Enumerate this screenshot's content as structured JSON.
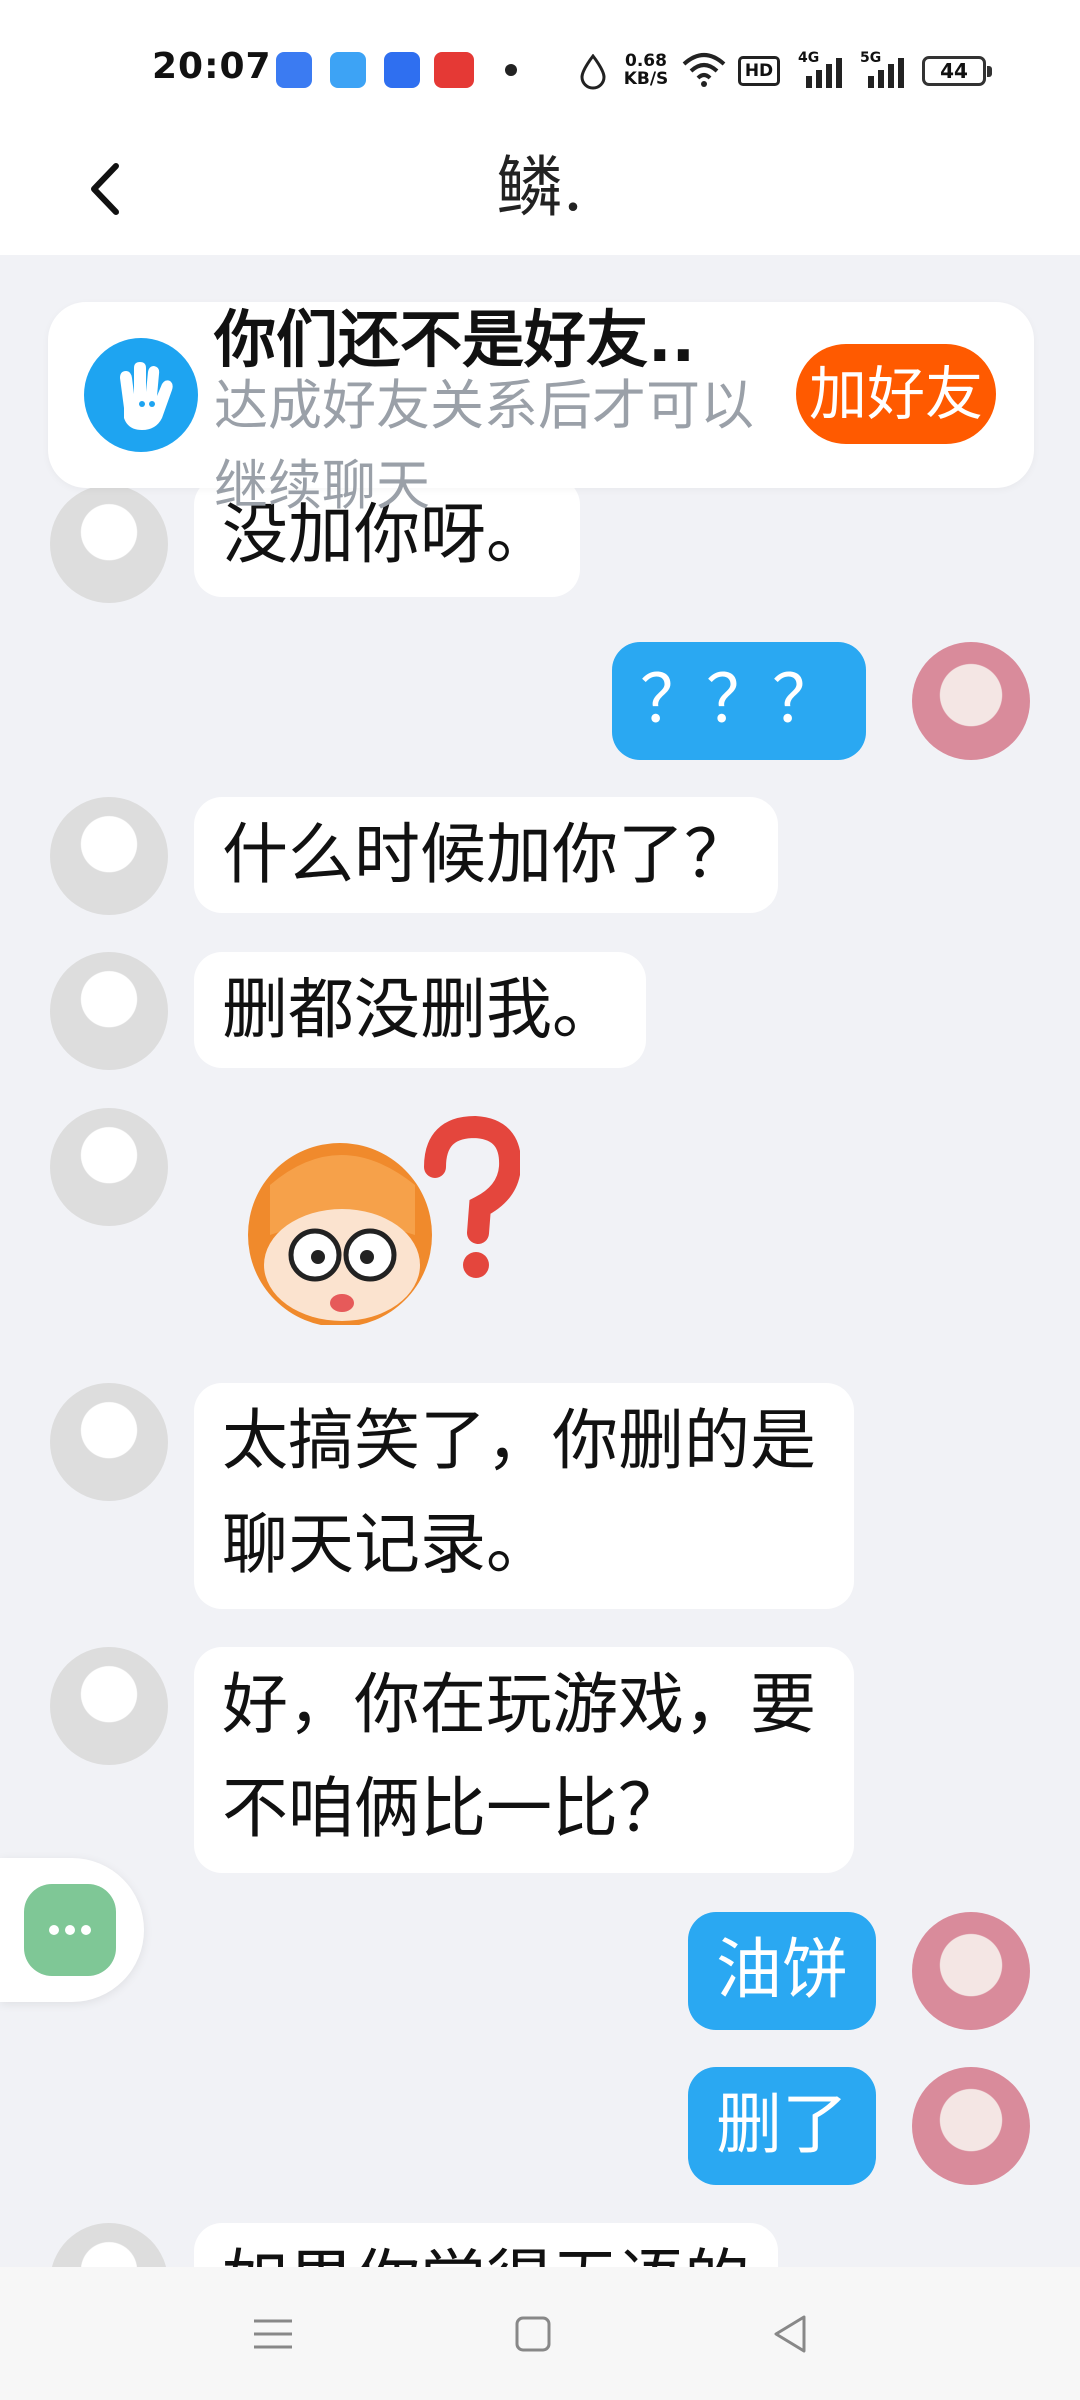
{
  "status": {
    "time": "20:07",
    "speed": "0.68 KB/S",
    "hd": "HD",
    "net1": "4G",
    "net2": "5G",
    "battery": "44"
  },
  "header": {
    "title": "鳞."
  },
  "banner": {
    "title": "你们还不是好友..",
    "subtitle": "达成好友关系后才可以继续聊天",
    "button": "加好友"
  },
  "messages": [
    {
      "side": "left",
      "text": "没加你呀。"
    },
    {
      "side": "right",
      "text": "？？？"
    },
    {
      "side": "left",
      "text": "什么时候加你了？"
    },
    {
      "side": "left",
      "text": "删都没删我。"
    },
    {
      "side": "left",
      "text": "",
      "sticker": "confused-face-sticker"
    },
    {
      "side": "left",
      "text": "太搞笑了，你删的是聊天记录。"
    },
    {
      "side": "left",
      "text": "好，你在玩游戏，要不咱俩比一比？"
    },
    {
      "side": "right",
      "text": "油饼"
    },
    {
      "side": "right",
      "text": "删了"
    },
    {
      "side": "left",
      "text": "如果你觉得无语的"
    }
  ]
}
